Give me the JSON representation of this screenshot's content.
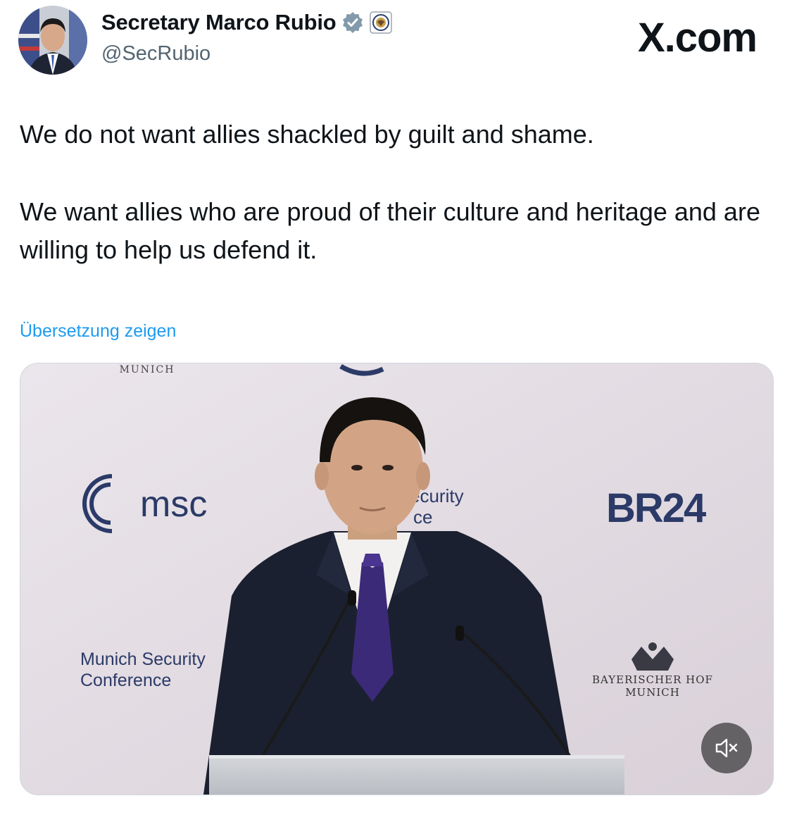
{
  "header": {
    "display_name": "Secretary Marco Rubio",
    "handle": "@SecRubio",
    "verified_badge_icon": "verified-badge-icon",
    "affiliate_badge_icon": "state-department-seal-icon",
    "watermark": "X.com"
  },
  "tweet": {
    "paragraphs": [
      "We do not want allies shackled by guilt and shame.",
      "We want allies who are proud of their culture and heritage and are willing to help us defend it."
    ],
    "translate_link": "Übersetzung zeigen"
  },
  "media": {
    "backdrop_texts": {
      "top_munich": "MUNICH",
      "msc_logo_text": "msc",
      "center_fragment_1": "ecurity",
      "center_fragment_2": "ce",
      "br24_logo": "BR24",
      "msc_line_1": "Munich Security",
      "msc_line_2": "Conference",
      "hotel_line_1": "BAYERISCHER HOF",
      "hotel_line_2": "MUNICH"
    },
    "mute_icon": "speaker-muted-icon"
  },
  "colors": {
    "link": "#1d9bf0",
    "text_primary": "#0f1419",
    "text_secondary": "#536471",
    "backdrop": "#e4dde3",
    "msc_blue": "#2b3a67"
  }
}
